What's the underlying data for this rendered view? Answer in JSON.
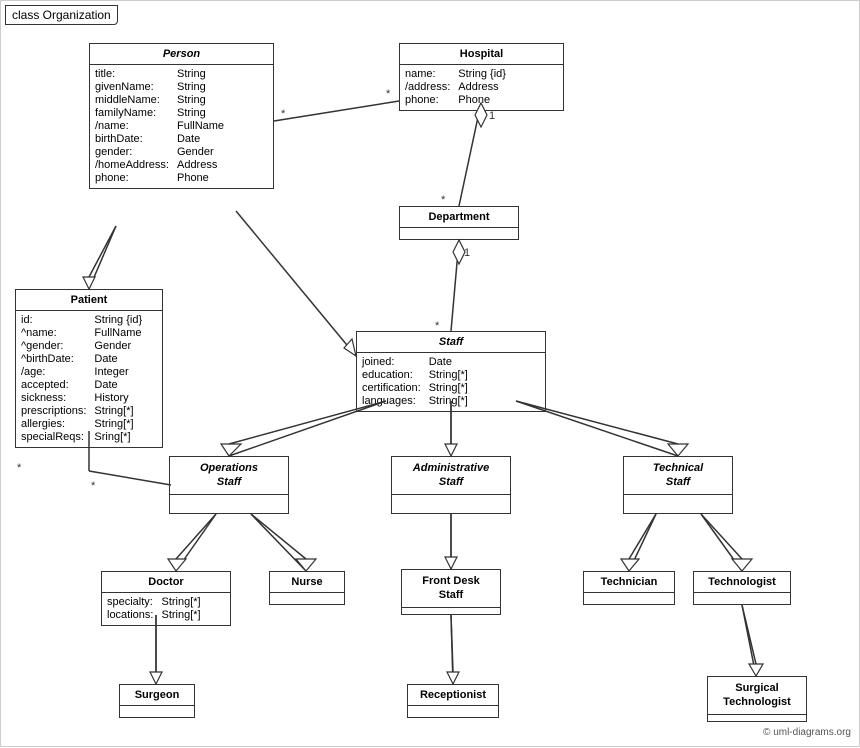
{
  "title": "class Organization",
  "copyright": "© uml-diagrams.org",
  "classes": {
    "person": {
      "name": "Person",
      "italic": true,
      "attrs": [
        [
          "title:",
          "String"
        ],
        [
          "givenName:",
          "String"
        ],
        [
          "middleName:",
          "String"
        ],
        [
          "familyName:",
          "String"
        ],
        [
          "/name:",
          "FullName"
        ],
        [
          "birthDate:",
          "Date"
        ],
        [
          "gender:",
          "Gender"
        ],
        [
          "/homeAddress:",
          "Address"
        ],
        [
          "phone:",
          "Phone"
        ]
      ]
    },
    "hospital": {
      "name": "Hospital",
      "italic": false,
      "attrs": [
        [
          "name:",
          "String {id}"
        ],
        [
          "/address:",
          "Address"
        ],
        [
          "phone:",
          "Phone"
        ]
      ]
    },
    "patient": {
      "name": "Patient",
      "italic": false,
      "attrs": [
        [
          "id:",
          "String {id}"
        ],
        [
          "^name:",
          "FullName"
        ],
        [
          "^gender:",
          "Gender"
        ],
        [
          "^birthDate:",
          "Date"
        ],
        [
          "/age:",
          "Integer"
        ],
        [
          "accepted:",
          "Date"
        ],
        [
          "sickness:",
          "History"
        ],
        [
          "prescriptions:",
          "String[*]"
        ],
        [
          "allergies:",
          "String[*]"
        ],
        [
          "specialReqs:",
          "Sring[*]"
        ]
      ]
    },
    "department": {
      "name": "Department",
      "italic": false,
      "attrs": []
    },
    "staff": {
      "name": "Staff",
      "italic": true,
      "attrs": [
        [
          "joined:",
          "Date"
        ],
        [
          "education:",
          "String[*]"
        ],
        [
          "certification:",
          "String[*]"
        ],
        [
          "languages:",
          "String[*]"
        ]
      ]
    },
    "operationsStaff": {
      "name": "Operations\nStaff",
      "italic": true,
      "attrs": []
    },
    "administrativeStaff": {
      "name": "Administrative\nStaff",
      "italic": true,
      "attrs": []
    },
    "technicalStaff": {
      "name": "Technical\nStaff",
      "italic": true,
      "attrs": []
    },
    "doctor": {
      "name": "Doctor",
      "italic": false,
      "attrs": [
        [
          "specialty:",
          "String[*]"
        ],
        [
          "locations:",
          "String[*]"
        ]
      ]
    },
    "nurse": {
      "name": "Nurse",
      "italic": false,
      "attrs": []
    },
    "frontDeskStaff": {
      "name": "Front Desk\nStaff",
      "italic": false,
      "attrs": []
    },
    "technician": {
      "name": "Technician",
      "italic": false,
      "attrs": []
    },
    "technologist": {
      "name": "Technologist",
      "italic": false,
      "attrs": []
    },
    "surgeon": {
      "name": "Surgeon",
      "italic": false,
      "attrs": []
    },
    "receptionist": {
      "name": "Receptionist",
      "italic": false,
      "attrs": []
    },
    "surgicalTechnologist": {
      "name": "Surgical\nTechnologist",
      "italic": false,
      "attrs": []
    }
  }
}
